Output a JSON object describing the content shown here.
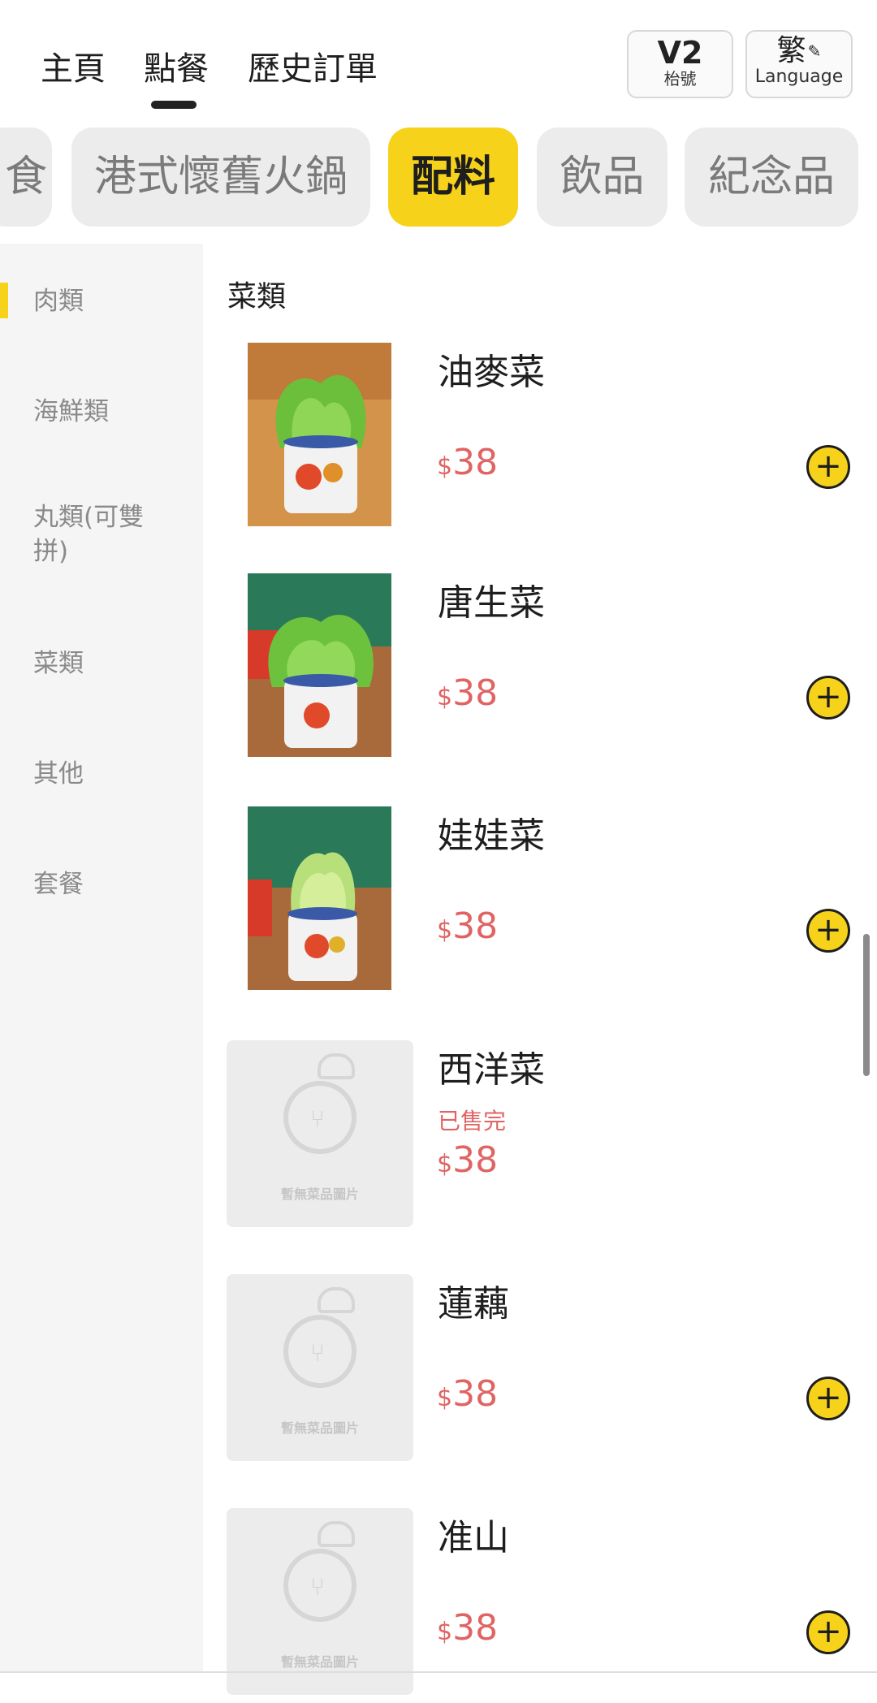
{
  "nav": {
    "tabs": [
      {
        "label": "主頁"
      },
      {
        "label": "點餐"
      },
      {
        "label": "歷史訂單"
      }
    ],
    "active_tab": "點餐",
    "table_number": "V2",
    "table_label": "枱號",
    "language_current": "繁",
    "language_label": "Language"
  },
  "categories": [
    {
      "label": "食"
    },
    {
      "label": "港式懷舊火鍋"
    },
    {
      "label": "配料"
    },
    {
      "label": "飲品"
    },
    {
      "label": "紀念品"
    }
  ],
  "active_category": "配料",
  "sidebar": {
    "items": [
      {
        "label": "肉類"
      },
      {
        "label": "海鮮類"
      },
      {
        "label": "丸類(可雙拼)"
      },
      {
        "label": "菜類"
      },
      {
        "label": "其他"
      },
      {
        "label": "套餐"
      }
    ],
    "active": "肉類"
  },
  "section": {
    "title": "菜類",
    "placeholder_text": "暫無菜品圖片",
    "currency": "$",
    "items": [
      {
        "name": "油麥菜",
        "price": "38",
        "sold_out": ""
      },
      {
        "name": "唐生菜",
        "price": "38",
        "sold_out": ""
      },
      {
        "name": "娃娃菜",
        "price": "38",
        "sold_out": ""
      },
      {
        "name": "西洋菜",
        "price": "38",
        "sold_out": "已售完"
      },
      {
        "name": "蓮藕",
        "price": "38",
        "sold_out": ""
      },
      {
        "name": "准山",
        "price": "38",
        "sold_out": ""
      }
    ]
  },
  "colors": {
    "accent": "#f7d21a",
    "price": "#e06464",
    "inactive_pill": "#ececec"
  }
}
